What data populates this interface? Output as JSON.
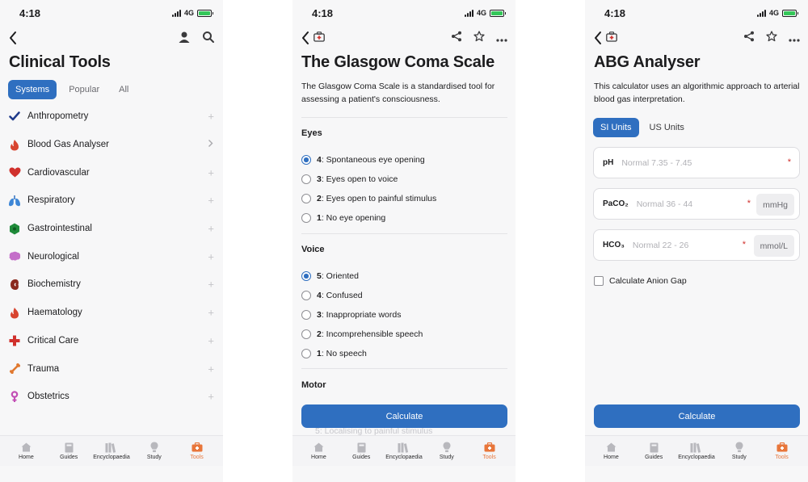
{
  "status_bar": {
    "time": "4:18",
    "network": "4G"
  },
  "colors": {
    "accent": "#2f6fc0",
    "active_tab": "#e8763b",
    "required": "#d0312d"
  },
  "tabbar": {
    "items": [
      {
        "label": "Home",
        "icon": "home-icon"
      },
      {
        "label": "Guides",
        "icon": "book-icon"
      },
      {
        "label": "Encyclopaedia",
        "icon": "books-icon"
      },
      {
        "label": "Study",
        "icon": "lightbulb-icon"
      },
      {
        "label": "Tools",
        "icon": "toolbox-icon",
        "active": true
      }
    ]
  },
  "screen1": {
    "title": "Clinical Tools",
    "segments": [
      "Systems",
      "Popular",
      "All"
    ],
    "active_segment": "Systems",
    "systems": [
      {
        "label": "Anthropometry",
        "icon": "checkmark-icon",
        "action": "plus"
      },
      {
        "label": "Blood Gas Analyser",
        "icon": "flame-icon",
        "action": "chevron"
      },
      {
        "label": "Cardiovascular",
        "icon": "heart-icon",
        "action": "plus"
      },
      {
        "label": "Respiratory",
        "icon": "lungs-icon",
        "action": "plus"
      },
      {
        "label": "Gastrointestinal",
        "icon": "hexagon-icon",
        "action": "plus"
      },
      {
        "label": "Neurological",
        "icon": "brain-icon",
        "action": "plus"
      },
      {
        "label": "Biochemistry",
        "icon": "kidney-icon",
        "action": "plus"
      },
      {
        "label": "Haematology",
        "icon": "flame-icon",
        "action": "plus"
      },
      {
        "label": "Critical Care",
        "icon": "cross-icon",
        "action": "plus"
      },
      {
        "label": "Trauma",
        "icon": "bone-icon",
        "action": "plus"
      },
      {
        "label": "Obstetrics",
        "icon": "female-icon",
        "action": "plus"
      }
    ]
  },
  "screen2": {
    "title": "The Glasgow Coma Scale",
    "description": "The Glasgow Coma Scale is a standardised tool for assessing a patient's consciousness.",
    "description_line1": "The Glasgow Coma Scale is a standardised tool for",
    "description_line2": "assessing a patient's consciousness.",
    "eyes": {
      "heading": "Eyes",
      "options": [
        {
          "score": "4",
          "text": ": Spontaneous eye opening",
          "selected": true
        },
        {
          "score": "3",
          "text": ": Eyes open to voice",
          "selected": false
        },
        {
          "score": "2",
          "text": ": Eyes open to painful stimulus",
          "selected": false
        },
        {
          "score": "1",
          "text": ": No eye opening",
          "selected": false
        }
      ]
    },
    "voice": {
      "heading": "Voice",
      "options": [
        {
          "score": "5",
          "text": ": Oriented",
          "selected": true
        },
        {
          "score": "4",
          "text": ": Confused",
          "selected": false
        },
        {
          "score": "3",
          "text": ": Inappropriate words",
          "selected": false
        },
        {
          "score": "2",
          "text": ": Incomprehensible speech",
          "selected": false
        },
        {
          "score": "1",
          "text": ": No speech",
          "selected": false
        }
      ]
    },
    "motor": {
      "heading": "Motor",
      "partial_option": "5: Localising to painful stimulus"
    },
    "calculate_label": "Calculate"
  },
  "screen3": {
    "title": "ABG Analyser",
    "description_line1": "This calculator uses an algorithmic approach to arterial",
    "description_line2": "blood gas interpretation.",
    "unit_tabs": [
      "SI Units",
      "US Units"
    ],
    "active_unit_tab": "SI Units",
    "fields": {
      "ph": {
        "label": "pH",
        "placeholder": "Normal 7.35 - 7.45",
        "unit": ""
      },
      "paco2": {
        "label": "PaCO₂",
        "placeholder": "Normal 36 - 44",
        "unit": "mmHg"
      },
      "hco3": {
        "label": "HCO₃",
        "placeholder": "Normal 22 - 26",
        "unit": "mmol/L"
      }
    },
    "required_mark": "*",
    "anion_gap_label": "Calculate Anion Gap",
    "calculate_label": "Calculate"
  }
}
